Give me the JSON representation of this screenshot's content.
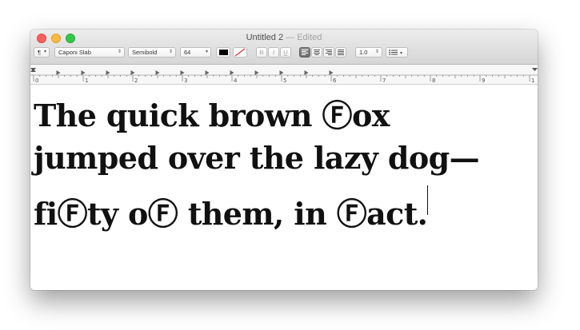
{
  "window": {
    "title": "Untitled 2",
    "title_separator": "—",
    "title_state": "Edited"
  },
  "toolbar": {
    "paragraph_style": "¶",
    "font_family": "Caponi Slab",
    "font_style": "Semibold",
    "font_size": "64",
    "bold": "B",
    "italic": "I",
    "underline": "U",
    "line_spacing": "1.0",
    "text_color": "#000000",
    "alignment_selected": "left"
  },
  "ruler": {
    "labels": [
      "0",
      "1",
      "2",
      "3",
      "4",
      "5",
      "6",
      "7",
      "8",
      "9",
      "1"
    ]
  },
  "document": {
    "lines": [
      "The quick brown Ⓕox",
      "jumped over the lazy dog—",
      "fiⒻty oⒻ them, in Ⓕact."
    ]
  },
  "icons": {
    "close": "close-button",
    "minimize": "minimize-button",
    "zoom": "zoom-button",
    "list": "list-bullets-icon"
  }
}
